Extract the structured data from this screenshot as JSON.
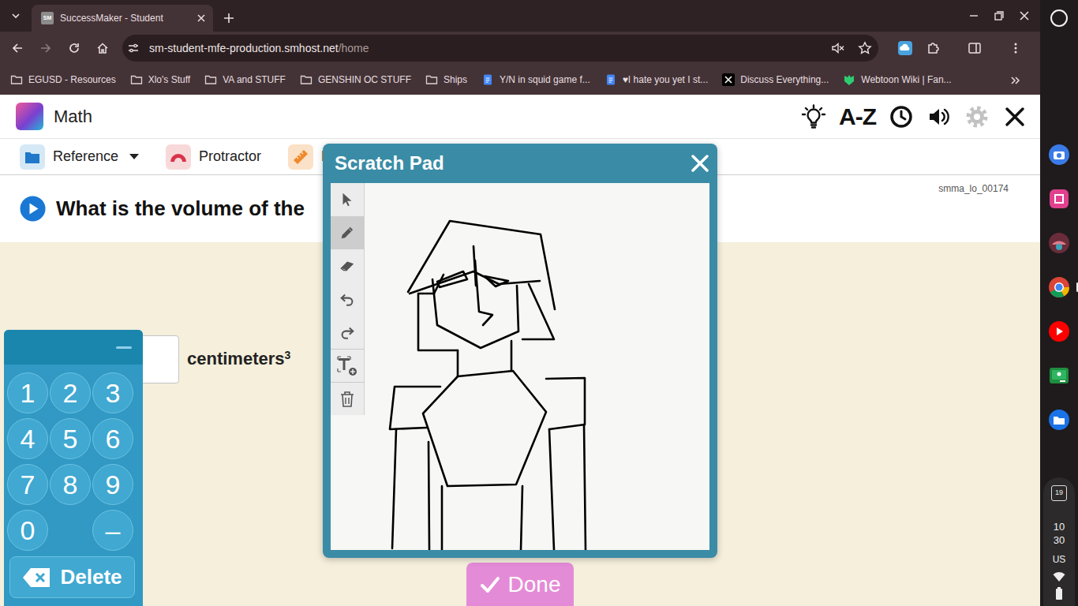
{
  "browser": {
    "tabs": [
      {
        "label": "SuccessMaker - Student",
        "favicon": "SM",
        "selected": true
      }
    ],
    "address": {
      "host": "sm-student-mfe-production.smhost.net",
      "path": "/home"
    },
    "bookmarks": [
      {
        "label": "EGUSD - Resources",
        "kind": "folder"
      },
      {
        "label": "Xlo's Stuff",
        "kind": "folder"
      },
      {
        "label": "VA and STUFF",
        "kind": "folder"
      },
      {
        "label": "GENSHIN OC STUFF",
        "kind": "folder"
      },
      {
        "label": "Ships",
        "kind": "folder"
      },
      {
        "label": "Y/N in squid game f...",
        "kind": "doc"
      },
      {
        "label": "♥I hate you yet I st...",
        "kind": "doc"
      },
      {
        "label": "Discuss Everything...",
        "kind": "x"
      },
      {
        "label": "Webtoon Wiki | Fan...",
        "kind": "fandom"
      }
    ]
  },
  "app": {
    "title": "Math",
    "az": "A-Z",
    "settings_disabled": true,
    "tools": [
      {
        "label": "Reference",
        "kind": "reference",
        "dropdown": true
      },
      {
        "label": "Protractor",
        "kind": "protractor",
        "dropdown": false
      },
      {
        "label": "R",
        "kind": "ruler",
        "dropdown": false
      }
    ]
  },
  "question": {
    "text": "What is the volume of the",
    "code": "smma_lo_00174",
    "unit": "centimeters",
    "exponent": "3"
  },
  "keypad": {
    "rows": [
      [
        "1",
        "2",
        "3"
      ],
      [
        "4",
        "5",
        "6"
      ],
      [
        "7",
        "8",
        "9"
      ],
      [
        "0",
        "–"
      ]
    ],
    "delete": "Delete"
  },
  "scratch_pad": {
    "title": "Scratch Pad",
    "tools": [
      {
        "kind": "select",
        "selected": false
      },
      {
        "kind": "pen",
        "selected": true
      },
      {
        "kind": "eraser",
        "selected": false
      },
      {
        "kind": "undo",
        "selected": false
      },
      {
        "kind": "redo",
        "selected": false
      },
      {
        "kind": "text",
        "selected": false
      },
      {
        "kind": "trash",
        "selected": false
      }
    ]
  },
  "done": "Done",
  "shelf": {
    "date": "19",
    "hour": "10",
    "minute": "30",
    "input": "US"
  }
}
